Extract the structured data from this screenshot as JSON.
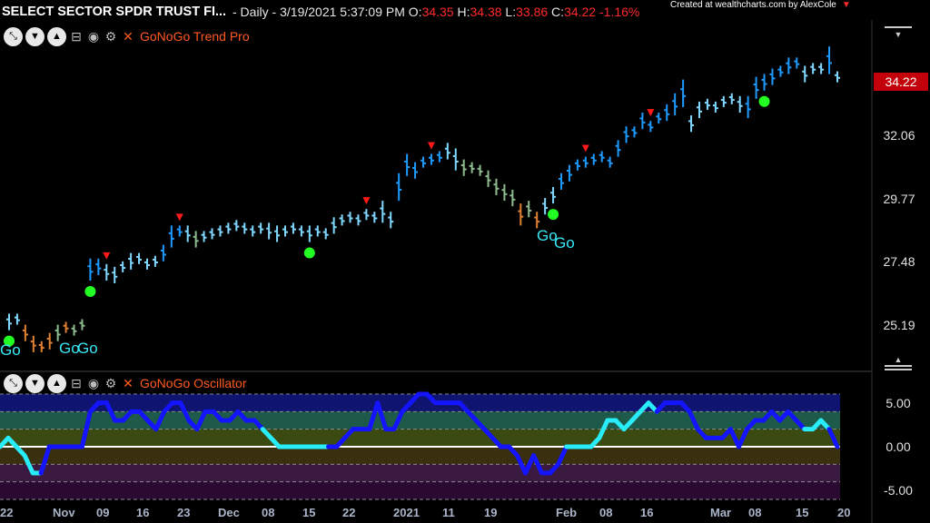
{
  "header": {
    "symbol": "SELECT SECTOR SPDR TRUST FI...",
    "interval": " - Daily - 3/19/2021 5:37:09 PM",
    "o_label": " O:",
    "o_val": "34.35",
    "h_label": " H:",
    "h_val": "34.38",
    "l_label": " L:",
    "l_val": "33.86",
    "c_label": " C:",
    "c_val": "34.22",
    "change": "  -1.16%"
  },
  "credit": "Created at wealthcharts.com by AlexCole",
  "panels": {
    "price_name": "GoNoGo Trend Pro",
    "osc_name": "GoNoGo Oscillator"
  },
  "current_price": "34.22",
  "go_labels": [
    "Go",
    "Go",
    "Go",
    "Go",
    "Go"
  ],
  "colors": {
    "bright_blue": "#1e9bff",
    "light_blue": "#7fd8ff",
    "aqua": "#3ef0f0",
    "olive": "#8fbc8f",
    "amber": "#e08030",
    "osc_blue": "#1414ff",
    "osc_aqua": "#28ecf8",
    "go_dot": "#22ff22",
    "no_go_marker": "#ff1a1a"
  },
  "chart_data": [
    {
      "type": "bar",
      "subtype": "ohlc",
      "title": "GoNoGo Trend Pro",
      "y_ticks": [
        "25.19",
        "27.48",
        "29.77",
        "32.06"
      ],
      "ylim": [
        23.8,
        36.0
      ],
      "x_ticks": [
        "22",
        "Nov",
        "09",
        "16",
        "23",
        "Dec",
        "08",
        "15",
        "22",
        "2021",
        "11",
        "19",
        "Feb",
        "08",
        "16",
        "Mar",
        "08",
        "15",
        "20"
      ],
      "bars": [
        {
          "c": 25.3,
          "r": 0.3,
          "col": "light_blue"
        },
        {
          "c": 25.4,
          "r": 0.2,
          "col": "light_blue"
        },
        {
          "c": 24.9,
          "r": 0.3,
          "col": "amber"
        },
        {
          "c": 24.5,
          "r": 0.3,
          "col": "amber"
        },
        {
          "c": 24.4,
          "r": 0.2,
          "col": "amber"
        },
        {
          "c": 24.6,
          "r": 0.3,
          "col": "amber"
        },
        {
          "c": 24.9,
          "r": 0.3,
          "col": "olive"
        },
        {
          "c": 25.1,
          "r": 0.2,
          "col": "amber"
        },
        {
          "c": 25.0,
          "r": 0.2,
          "col": "olive"
        },
        {
          "c": 25.2,
          "r": 0.2,
          "col": "olive"
        },
        {
          "c": 27.2,
          "r": 0.4,
          "col": "bright_blue"
        },
        {
          "c": 27.3,
          "r": 0.3,
          "col": "bright_blue"
        },
        {
          "c": 27.1,
          "r": 0.3,
          "col": "light_blue"
        },
        {
          "c": 27.0,
          "r": 0.3,
          "col": "light_blue"
        },
        {
          "c": 27.3,
          "r": 0.2,
          "col": "light_blue"
        },
        {
          "c": 27.5,
          "r": 0.3,
          "col": "light_blue"
        },
        {
          "c": 27.6,
          "r": 0.2,
          "col": "light_blue"
        },
        {
          "c": 27.4,
          "r": 0.2,
          "col": "light_blue"
        },
        {
          "c": 27.5,
          "r": 0.2,
          "col": "light_blue"
        },
        {
          "c": 27.8,
          "r": 0.3,
          "col": "bright_blue"
        },
        {
          "c": 28.4,
          "r": 0.4,
          "col": "bright_blue"
        },
        {
          "c": 28.6,
          "r": 0.2,
          "col": "bright_blue"
        },
        {
          "c": 28.5,
          "r": 0.3,
          "col": "light_blue"
        },
        {
          "c": 28.3,
          "r": 0.3,
          "col": "olive"
        },
        {
          "c": 28.4,
          "r": 0.2,
          "col": "light_blue"
        },
        {
          "c": 28.5,
          "r": 0.2,
          "col": "light_blue"
        },
        {
          "c": 28.6,
          "r": 0.2,
          "col": "light_blue"
        },
        {
          "c": 28.7,
          "r": 0.2,
          "col": "light_blue"
        },
        {
          "c": 28.8,
          "r": 0.2,
          "col": "light_blue"
        },
        {
          "c": 28.7,
          "r": 0.2,
          "col": "light_blue"
        },
        {
          "c": 28.6,
          "r": 0.2,
          "col": "light_blue"
        },
        {
          "c": 28.7,
          "r": 0.2,
          "col": "light_blue"
        },
        {
          "c": 28.6,
          "r": 0.3,
          "col": "light_blue"
        },
        {
          "c": 28.5,
          "r": 0.3,
          "col": "light_blue"
        },
        {
          "c": 28.6,
          "r": 0.2,
          "col": "light_blue"
        },
        {
          "c": 28.7,
          "r": 0.2,
          "col": "light_blue"
        },
        {
          "c": 28.6,
          "r": 0.2,
          "col": "light_blue"
        },
        {
          "c": 28.5,
          "r": 0.3,
          "col": "light_blue"
        },
        {
          "c": 28.6,
          "r": 0.2,
          "col": "light_blue"
        },
        {
          "c": 28.5,
          "r": 0.2,
          "col": "light_blue"
        },
        {
          "c": 28.8,
          "r": 0.3,
          "col": "light_blue"
        },
        {
          "c": 29.0,
          "r": 0.2,
          "col": "light_blue"
        },
        {
          "c": 29.1,
          "r": 0.2,
          "col": "light_blue"
        },
        {
          "c": 29.0,
          "r": 0.2,
          "col": "light_blue"
        },
        {
          "c": 29.2,
          "r": 0.2,
          "col": "light_blue"
        },
        {
          "c": 29.1,
          "r": 0.2,
          "col": "light_blue"
        },
        {
          "c": 29.3,
          "r": 0.4,
          "col": "light_blue"
        },
        {
          "c": 29.0,
          "r": 0.3,
          "col": "light_blue"
        },
        {
          "c": 30.2,
          "r": 0.5,
          "col": "bright_blue"
        },
        {
          "c": 31.0,
          "r": 0.4,
          "col": "bright_blue"
        },
        {
          "c": 30.8,
          "r": 0.3,
          "col": "bright_blue"
        },
        {
          "c": 31.1,
          "r": 0.2,
          "col": "bright_blue"
        },
        {
          "c": 31.2,
          "r": 0.2,
          "col": "bright_blue"
        },
        {
          "c": 31.3,
          "r": 0.2,
          "col": "bright_blue"
        },
        {
          "c": 31.5,
          "r": 0.3,
          "col": "light_blue"
        },
        {
          "c": 31.2,
          "r": 0.4,
          "col": "light_blue"
        },
        {
          "c": 30.9,
          "r": 0.3,
          "col": "olive"
        },
        {
          "c": 30.9,
          "r": 0.2,
          "col": "olive"
        },
        {
          "c": 30.8,
          "r": 0.2,
          "col": "olive"
        },
        {
          "c": 30.5,
          "r": 0.3,
          "col": "olive"
        },
        {
          "c": 30.2,
          "r": 0.3,
          "col": "olive"
        },
        {
          "c": 30.0,
          "r": 0.3,
          "col": "olive"
        },
        {
          "c": 29.8,
          "r": 0.3,
          "col": "olive"
        },
        {
          "c": 29.2,
          "r": 0.4,
          "col": "amber"
        },
        {
          "c": 29.4,
          "r": 0.3,
          "col": "olive"
        },
        {
          "c": 29.0,
          "r": 0.3,
          "col": "amber"
        },
        {
          "c": 29.5,
          "r": 0.3,
          "col": "light_blue"
        },
        {
          "c": 29.9,
          "r": 0.3,
          "col": "light_blue"
        },
        {
          "c": 30.4,
          "r": 0.3,
          "col": "bright_blue"
        },
        {
          "c": 30.7,
          "r": 0.3,
          "col": "bright_blue"
        },
        {
          "c": 31.0,
          "r": 0.2,
          "col": "bright_blue"
        },
        {
          "c": 31.1,
          "r": 0.2,
          "col": "bright_blue"
        },
        {
          "c": 31.2,
          "r": 0.2,
          "col": "bright_blue"
        },
        {
          "c": 31.3,
          "r": 0.2,
          "col": "bright_blue"
        },
        {
          "c": 31.1,
          "r": 0.2,
          "col": "bright_blue"
        },
        {
          "c": 31.6,
          "r": 0.3,
          "col": "bright_blue"
        },
        {
          "c": 32.1,
          "r": 0.3,
          "col": "bright_blue"
        },
        {
          "c": 32.2,
          "r": 0.2,
          "col": "bright_blue"
        },
        {
          "c": 32.6,
          "r": 0.3,
          "col": "bright_blue"
        },
        {
          "c": 32.4,
          "r": 0.2,
          "col": "bright_blue"
        },
        {
          "c": 32.7,
          "r": 0.2,
          "col": "bright_blue"
        },
        {
          "c": 32.9,
          "r": 0.3,
          "col": "bright_blue"
        },
        {
          "c": 33.2,
          "r": 0.4,
          "col": "bright_blue"
        },
        {
          "c": 33.6,
          "r": 0.5,
          "col": "bright_blue"
        },
        {
          "c": 32.5,
          "r": 0.3,
          "col": "light_blue"
        },
        {
          "c": 33.0,
          "r": 0.3,
          "col": "light_blue"
        },
        {
          "c": 33.2,
          "r": 0.2,
          "col": "light_blue"
        },
        {
          "c": 33.1,
          "r": 0.2,
          "col": "light_blue"
        },
        {
          "c": 33.3,
          "r": 0.2,
          "col": "light_blue"
        },
        {
          "c": 33.4,
          "r": 0.2,
          "col": "light_blue"
        },
        {
          "c": 33.2,
          "r": 0.3,
          "col": "light_blue"
        },
        {
          "c": 33.1,
          "r": 0.4,
          "col": "bright_blue"
        },
        {
          "c": 33.8,
          "r": 0.4,
          "col": "bright_blue"
        },
        {
          "c": 34.0,
          "r": 0.3,
          "col": "bright_blue"
        },
        {
          "c": 34.2,
          "r": 0.3,
          "col": "bright_blue"
        },
        {
          "c": 34.4,
          "r": 0.2,
          "col": "bright_blue"
        },
        {
          "c": 34.6,
          "r": 0.3,
          "col": "bright_blue"
        },
        {
          "c": 34.7,
          "r": 0.2,
          "col": "bright_blue"
        },
        {
          "c": 34.3,
          "r": 0.3,
          "col": "light_blue"
        },
        {
          "c": 34.5,
          "r": 0.2,
          "col": "light_blue"
        },
        {
          "c": 34.5,
          "r": 0.2,
          "col": "light_blue"
        },
        {
          "c": 34.8,
          "r": 0.5,
          "col": "bright_blue"
        },
        {
          "c": 34.2,
          "r": 0.2,
          "col": "light_blue"
        }
      ],
      "go_dots": [
        0,
        10,
        37,
        67,
        93
      ],
      "nogo_markers": [
        12,
        21,
        44,
        52,
        71,
        79
      ]
    },
    {
      "type": "line",
      "title": "GoNoGo Oscillator",
      "y_ticks": [
        "5.00",
        "0.00",
        "-5.00"
      ],
      "ylim": [
        -6.0,
        6.0
      ],
      "values": [
        0,
        1,
        0,
        -1,
        -3,
        -3,
        0,
        0,
        0,
        0,
        0,
        4,
        5,
        5,
        3,
        3,
        4,
        4,
        3,
        2,
        4,
        5,
        5,
        3,
        2,
        4,
        4,
        3,
        3,
        4,
        3,
        3,
        2,
        1,
        0,
        0,
        0,
        0,
        0,
        0,
        0,
        0,
        1,
        2,
        2,
        2,
        5,
        2,
        2,
        4,
        5,
        6,
        6,
        5,
        5,
        5,
        5,
        4,
        3,
        2,
        1,
        0,
        0,
        -1,
        -3,
        -1,
        -3,
        -3,
        -2,
        0,
        0,
        0,
        0,
        1,
        3,
        3,
        2,
        3,
        4,
        5,
        4,
        5,
        5,
        5,
        4,
        2,
        1,
        1,
        1,
        2,
        0,
        2,
        3,
        3,
        4,
        3,
        4,
        3,
        2,
        2,
        3,
        2,
        0
      ],
      "series_colors": [
        "osc_aqua",
        "osc_aqua",
        "osc_aqua",
        "osc_aqua",
        "osc_aqua",
        "osc_blue",
        "osc_blue",
        "osc_blue",
        "osc_blue",
        "osc_blue",
        "osc_blue",
        "osc_blue",
        "osc_blue",
        "osc_blue",
        "osc_blue",
        "osc_blue",
        "osc_blue",
        "osc_blue",
        "osc_blue",
        "osc_blue",
        "osc_blue",
        "osc_blue",
        "osc_blue",
        "osc_blue",
        "osc_blue",
        "osc_blue",
        "osc_blue",
        "osc_blue",
        "osc_blue",
        "osc_blue",
        "osc_blue",
        "osc_blue",
        "osc_aqua",
        "osc_aqua",
        "osc_aqua",
        "osc_aqua",
        "osc_aqua",
        "osc_aqua",
        "osc_aqua",
        "osc_aqua",
        "osc_blue",
        "osc_blue",
        "osc_blue",
        "osc_blue",
        "osc_blue",
        "osc_blue",
        "osc_blue",
        "osc_blue",
        "osc_blue",
        "osc_blue",
        "osc_blue",
        "osc_blue",
        "osc_blue",
        "osc_blue",
        "osc_blue",
        "osc_blue",
        "osc_blue",
        "osc_blue",
        "osc_blue",
        "osc_blue",
        "osc_blue",
        "osc_blue",
        "osc_blue",
        "osc_blue",
        "osc_blue",
        "osc_blue",
        "osc_blue",
        "osc_blue",
        "osc_blue",
        "osc_aqua",
        "osc_aqua",
        "osc_aqua",
        "osc_aqua",
        "osc_aqua",
        "osc_aqua",
        "osc_aqua",
        "osc_aqua",
        "osc_aqua",
        "osc_aqua",
        "osc_aqua",
        "osc_blue",
        "osc_blue",
        "osc_blue",
        "osc_blue",
        "osc_blue",
        "osc_blue",
        "osc_blue",
        "osc_blue",
        "osc_blue",
        "osc_blue",
        "osc_blue",
        "osc_blue",
        "osc_blue",
        "osc_blue",
        "osc_blue",
        "osc_blue",
        "osc_blue",
        "osc_blue",
        "osc_aqua",
        "osc_aqua",
        "osc_aqua",
        "osc_blue",
        "osc_blue"
      ],
      "bands": [
        {
          "from": 6.0,
          "to": 4.0,
          "color": "#0e1470"
        },
        {
          "from": 4.0,
          "to": 2.0,
          "color": "#1e5a4a"
        },
        {
          "from": 2.0,
          "to": 0.0,
          "color": "#3a4a10"
        },
        {
          "from": 0.0,
          "to": -2.0,
          "color": "#3a3010"
        },
        {
          "from": -2.0,
          "to": -4.0,
          "color": "#3a1a40"
        },
        {
          "from": -4.0,
          "to": -6.0,
          "color": "#2a0a30"
        }
      ]
    }
  ]
}
